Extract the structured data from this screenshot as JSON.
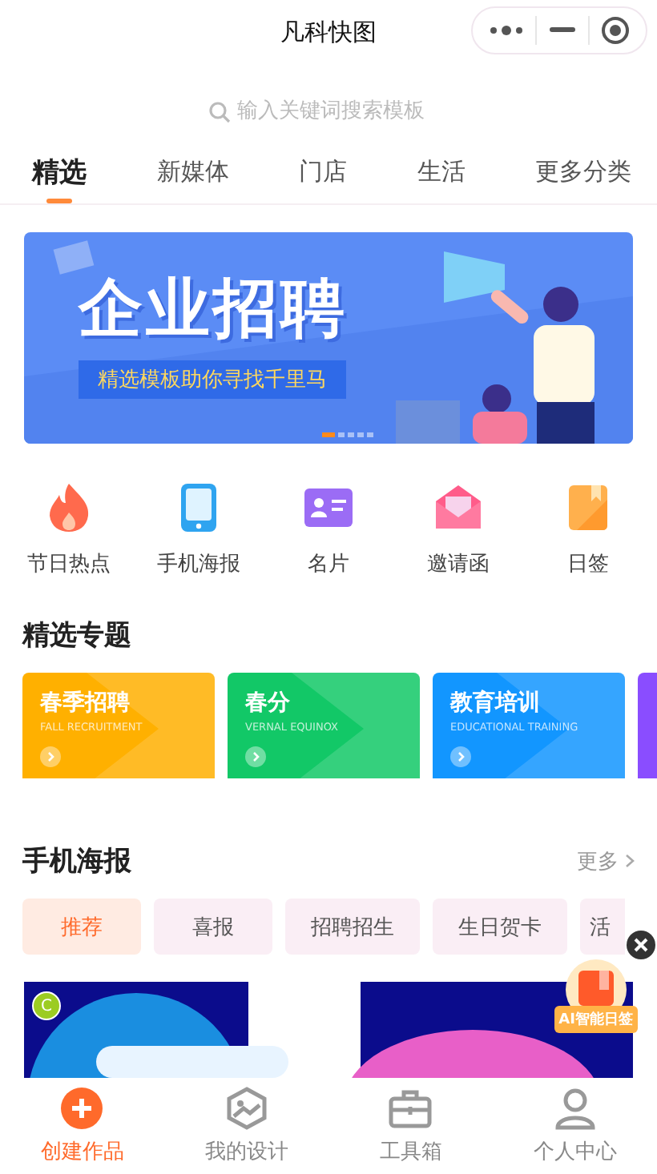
{
  "window": {
    "title": "凡科快图"
  },
  "search": {
    "placeholder": "输入关键词搜索模板"
  },
  "tabs": [
    {
      "label": "精选",
      "selected": true
    },
    {
      "label": "新媒体",
      "selected": false
    },
    {
      "label": "门店",
      "selected": false
    },
    {
      "label": "生活",
      "selected": false
    },
    {
      "label": "更多分类",
      "selected": false
    }
  ],
  "banner": {
    "title": "企业招聘",
    "subtitle": "精选模板助你寻找千里马",
    "slides": [
      {
        "selected": true
      },
      {
        "selected": false
      },
      {
        "selected": false
      },
      {
        "selected": false
      },
      {
        "selected": false
      }
    ]
  },
  "shortcuts": [
    {
      "label": "节日热点",
      "kind": "flame"
    },
    {
      "label": "手机海报",
      "kind": "phone"
    },
    {
      "label": "名片",
      "kind": "card"
    },
    {
      "label": "邀请函",
      "kind": "envelope"
    },
    {
      "label": "日签",
      "kind": "note"
    }
  ],
  "topics": {
    "heading": "精选专题",
    "items": [
      {
        "title": "春季招聘",
        "subtitle": "FALL RECRUITMENT",
        "color": "#ffb000"
      },
      {
        "title": "春分",
        "subtitle": "VERNAL EQUINOX",
        "color": "#12c867"
      },
      {
        "title": "教育培训",
        "subtitle": "EDUCATIONAL TRAINING",
        "color": "#1296ff"
      },
      {
        "color": "#8a4dff"
      }
    ]
  },
  "posters": {
    "heading": "手机海报",
    "more": "更多",
    "chips": [
      {
        "label": "推荐",
        "selected": true
      },
      {
        "label": "喜报",
        "selected": false
      },
      {
        "label": "招聘招生",
        "selected": false
      },
      {
        "label": "生日贺卡",
        "selected": false
      },
      {
        "label": "活",
        "selected": false
      }
    ],
    "preview": {
      "badge": "C"
    }
  },
  "float_badge": {
    "label": "AI智能日签"
  },
  "bottom_nav": [
    {
      "label": "创建作品",
      "kind": "plus",
      "selected": true
    },
    {
      "label": "我的设计",
      "kind": "gallery",
      "selected": false
    },
    {
      "label": "工具箱",
      "kind": "toolbox",
      "selected": false
    },
    {
      "label": "个人中心",
      "kind": "person",
      "selected": false
    }
  ]
}
